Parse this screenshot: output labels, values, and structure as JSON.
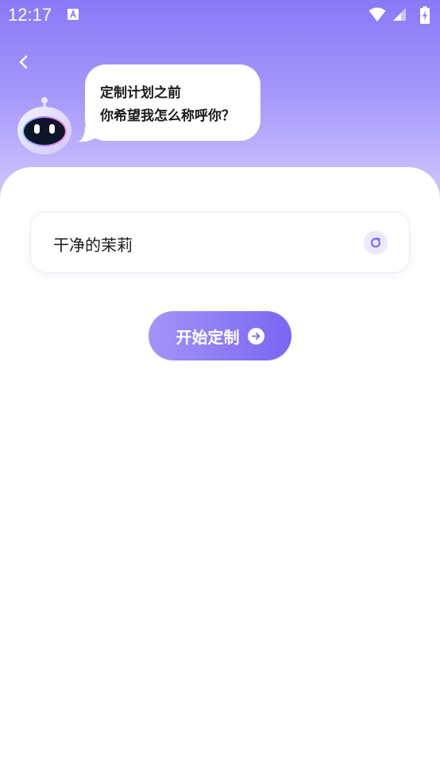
{
  "status_bar": {
    "time": "12:17",
    "icons": [
      "text-a-icon",
      "wifi-icon",
      "cellular-signal-icon",
      "battery-charging-icon"
    ]
  },
  "header": {
    "back_icon": "chevron-left-icon",
    "avatar": "robot-avatar",
    "bubble_line1": "定制计划之前",
    "bubble_line2": "你希望我怎么称呼你？"
  },
  "name_input": {
    "value": "干净的茉莉",
    "refresh_icon": "refresh-icon"
  },
  "start_button": {
    "label": "开始定制",
    "icon": "arrow-right-circle-icon"
  },
  "colors": {
    "gradient_top": "#8a79f7",
    "gradient_bottom": "#d4ccfd",
    "button_start": "#a394f7",
    "button_end": "#7a66f2",
    "refresh_bg": "#ece8fd",
    "refresh_icon": "#7a66f2"
  }
}
